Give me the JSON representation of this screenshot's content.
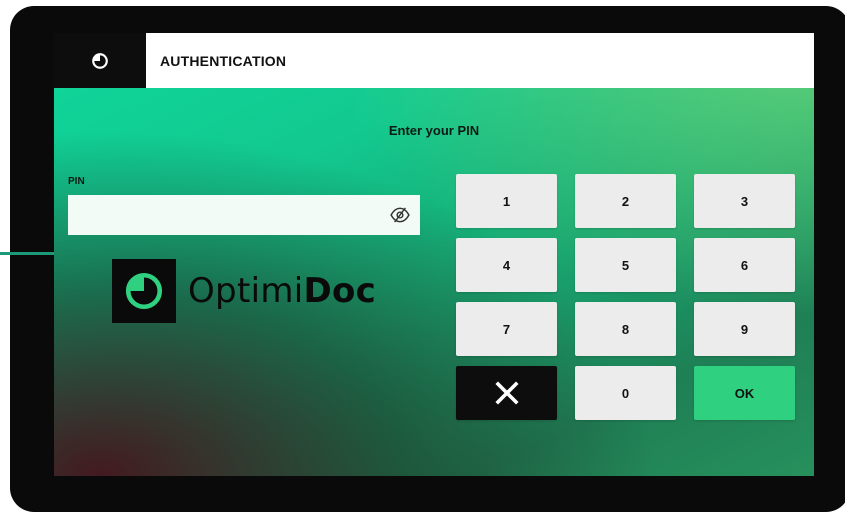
{
  "header": {
    "title": "AUTHENTICATION",
    "home_icon": "optimidoc-logo-icon"
  },
  "prompt": "Enter your PIN",
  "pin": {
    "label": "PIN",
    "value": "",
    "placeholder": "",
    "toggle_icon": "eye-off-icon"
  },
  "logo": {
    "text_regular": "Optimi",
    "text_bold": "Doc",
    "icon": "optimidoc-logo-icon"
  },
  "keypad": {
    "keys": [
      "1",
      "2",
      "3",
      "4",
      "5",
      "6",
      "7",
      "8",
      "9"
    ],
    "delete_icon": "close-icon",
    "zero": "0",
    "ok": "OK"
  },
  "colors": {
    "accent": "#2fd181",
    "header_bg": "#ffffff",
    "dark": "#0d0d0d",
    "key_bg": "#ececec"
  }
}
